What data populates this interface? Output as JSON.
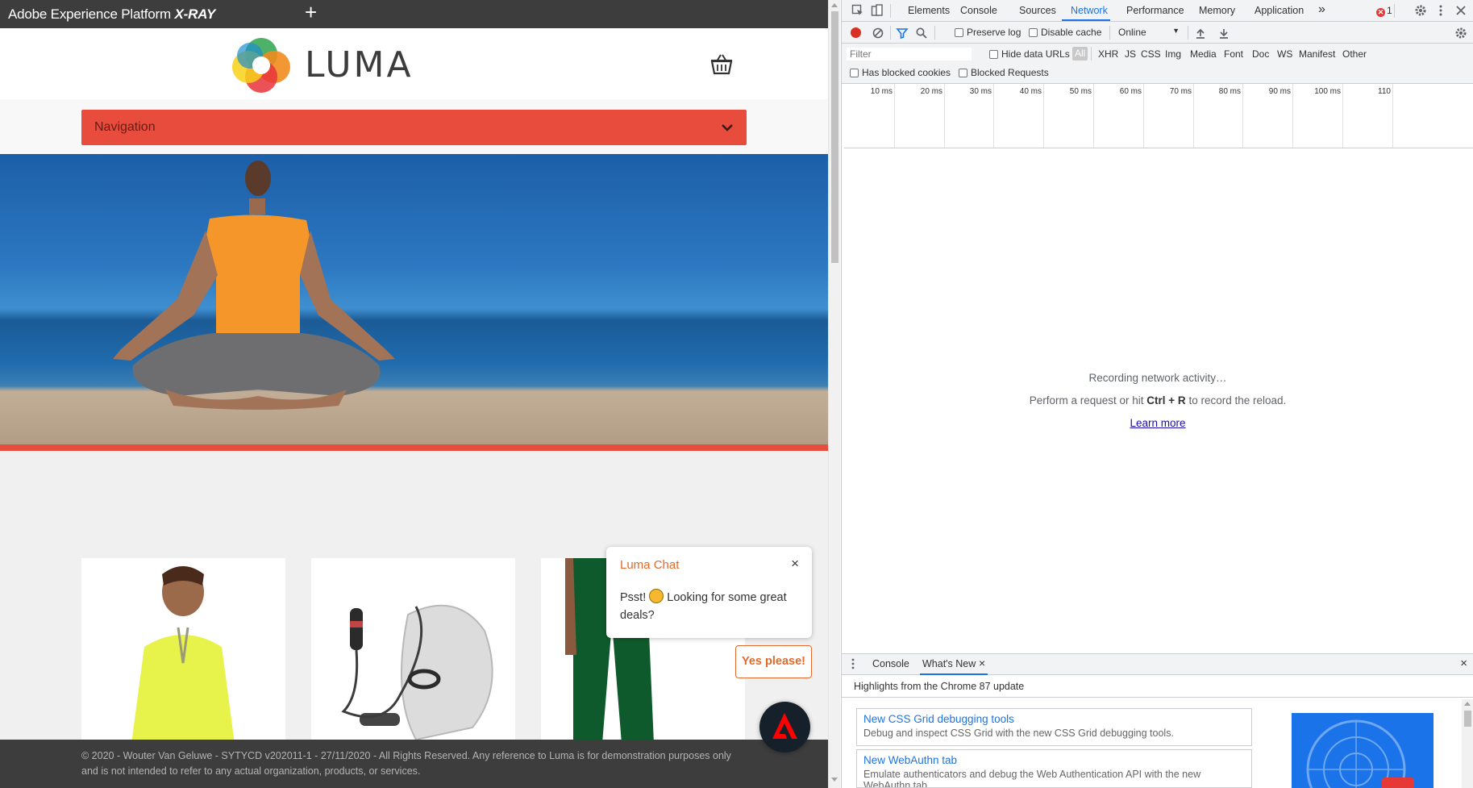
{
  "xray": {
    "title_prefix": "Adobe Experience Platform",
    "title_brand": "X-RAY",
    "plus_icon": "plus-icon"
  },
  "site": {
    "brand": "LUMA",
    "logo_icon": "luma-logo-icon",
    "cart_icon": "shopping-basket-icon",
    "navigation_label": "Navigation",
    "nav_toggle_icon": "chevron-down-icon",
    "hero_image": "woman-meditating-on-beach",
    "products": [
      {
        "image": "yellow-zip-pullover"
      },
      {
        "image": "jump-ropes-and-bag"
      },
      {
        "image": "green-pants"
      }
    ],
    "footer_text": "© 2020 - Wouter Van Geluwe - SYTYCD v202011-1 - 27/11/2020 - All Rights Reserved. Any reference to Luma is for demonstration purposes only and is not intended to refer to any actual organization, products, or services.",
    "colors": {
      "accent": "#e84c3d",
      "chat_accent": "#e26a2c",
      "dark_bar": "#3d3d3d"
    }
  },
  "chat": {
    "title": "Luma Chat",
    "close_label": "×",
    "message_before": "Psst!",
    "emoji": "winking-face-emoji",
    "message_after": "Looking for some great deals?",
    "yes_label": "Yes please!",
    "launcher_icon": "adobe-logo-icon"
  },
  "devtools": {
    "tabs": [
      "Elements",
      "Console",
      "Sources",
      "Network",
      "Performance",
      "Memory",
      "Application"
    ],
    "active_tab": "Network",
    "more_tabs_label": "»",
    "error_count": "1",
    "toolbar": {
      "preserve_log": "Preserve log",
      "disable_cache": "Disable cache",
      "throttling": "Online"
    },
    "filter": {
      "placeholder": "Filter",
      "hide_data_urls": "Hide data URLs",
      "types": [
        "All",
        "XHR",
        "JS",
        "CSS",
        "Img",
        "Media",
        "Font",
        "Doc",
        "WS",
        "Manifest",
        "Other"
      ],
      "has_blocked_cookies": "Has blocked cookies",
      "blocked_requests": "Blocked Requests"
    },
    "timeline_ticks": [
      "10 ms",
      "20 ms",
      "30 ms",
      "40 ms",
      "50 ms",
      "60 ms",
      "70 ms",
      "80 ms",
      "90 ms",
      "100 ms",
      "110"
    ],
    "empty_state": {
      "line1": "Recording network activity…",
      "line2_before": "Perform a request or hit",
      "line2_key": "Ctrl + R",
      "line2_after": "to record the reload.",
      "learn_more": "Learn more"
    },
    "drawer": {
      "tabs": [
        "Console",
        "What's New"
      ],
      "active_tab": "What's New",
      "close_tab_label": "×",
      "close_drawer_label": "×",
      "heading": "Highlights from the Chrome 87 update",
      "cards": [
        {
          "title": "New CSS Grid debugging tools",
          "description": "Debug and inspect CSS Grid with the new CSS Grid debugging tools."
        },
        {
          "title": "New WebAuthn tab",
          "description": "Emulate authenticators and debug the Web Authentication API with the new WebAuthn tab."
        }
      ]
    }
  }
}
